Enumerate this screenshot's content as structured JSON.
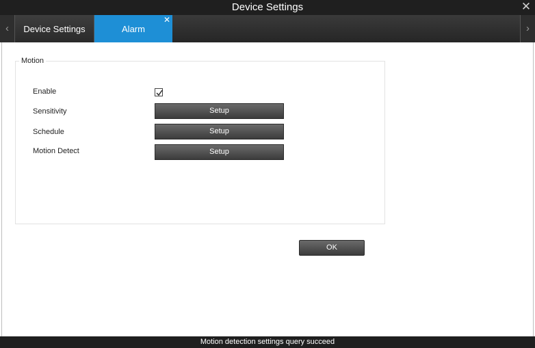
{
  "window": {
    "title": "Device Settings"
  },
  "tabs": [
    {
      "label": "Device Settings",
      "active": false
    },
    {
      "label": "Alarm",
      "active": true
    }
  ],
  "motion": {
    "group_title": "Motion",
    "enable_label": "Enable",
    "enable_checked": true,
    "rows": [
      {
        "label": "Sensitivity",
        "button": "Setup"
      },
      {
        "label": "Schedule",
        "button": "Setup"
      },
      {
        "label": "Motion Detect",
        "button": "Setup"
      }
    ]
  },
  "ok_label": "OK",
  "status": "Motion detection settings query succeed",
  "colors": {
    "accent": "#1e8fd6",
    "titlebar": "#1f1f1f"
  },
  "icons": {
    "close": "close-icon",
    "tab_close": "close-icon",
    "left": "chevron-left-icon",
    "right": "chevron-right-icon"
  }
}
